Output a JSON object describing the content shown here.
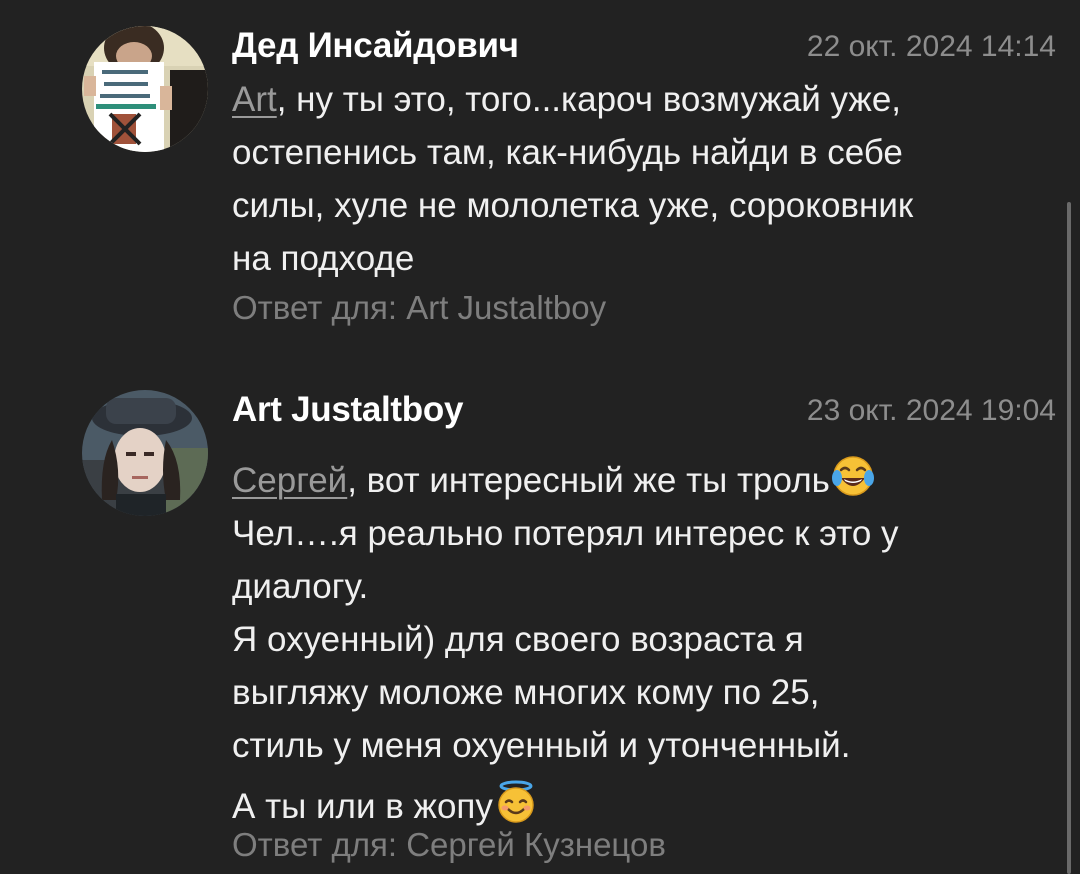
{
  "comments": [
    {
      "author": "Дед Инсайдович",
      "date": "22 окт. 2024 14:14",
      "mention": "Art",
      "lines": [
        ", ну ты это, того...кароч возмужай уже,",
        "остепенись там, как-нибудь найди в себе",
        "силы, хуле не мололетка уже, сороковник",
        "на подходе"
      ],
      "reply_to": "Ответ для: Art Justaltboy",
      "avatar_icon": "protest-sign-photo"
    },
    {
      "author": "Art Justaltboy",
      "date": "23 окт. 2024 19:04",
      "mention": "Сергей",
      "lines": [
        ", вот интересный же ты троль",
        "Чел….я реально потерял интерес к это у",
        "диалогу.",
        "Я охуенный) для своего возраста я",
        "выгляжу моложе многих кому по 25,",
        "стиль у меня охуенный и утонченный.",
        "А ты или в жопу"
      ],
      "reply_to": "Ответ для: Сергей Кузнецов",
      "avatar_icon": "hat-man-photo",
      "emoji_laugh": "face-with-tears-of-joy-icon",
      "emoji_halo": "smiling-face-with-halo-icon"
    }
  ],
  "colors": {
    "background": "#222222",
    "text": "#f0f0f0",
    "meta": "#8d8d8d",
    "emoji": "#f7c136"
  }
}
